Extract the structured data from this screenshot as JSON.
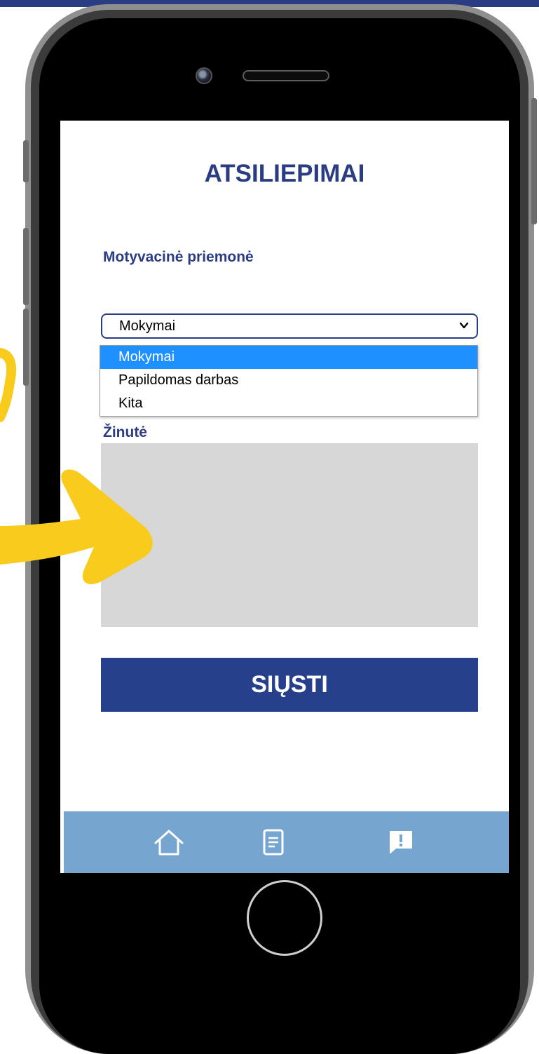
{
  "screen": {
    "title": "ATSILIEPIMAI",
    "motivation_label": "Motyvacinė priemonė",
    "select": {
      "selected": "Mokymai",
      "options": [
        "Mokymai",
        "Papildomas darbas",
        "Kita"
      ]
    },
    "message_label": "Žinutė",
    "message_value": "",
    "send_label": "SIŲSTI"
  },
  "bottom_nav": {
    "items": [
      {
        "icon": "home-icon"
      },
      {
        "icon": "document-icon"
      },
      {
        "icon": "feedback-icon"
      }
    ]
  },
  "colors": {
    "brand_blue": "#2a3d83",
    "button_blue": "#27408b",
    "nav_background": "#76a5cf",
    "highlight": "#1e90ff",
    "arrow_yellow": "#f8cb1c"
  }
}
